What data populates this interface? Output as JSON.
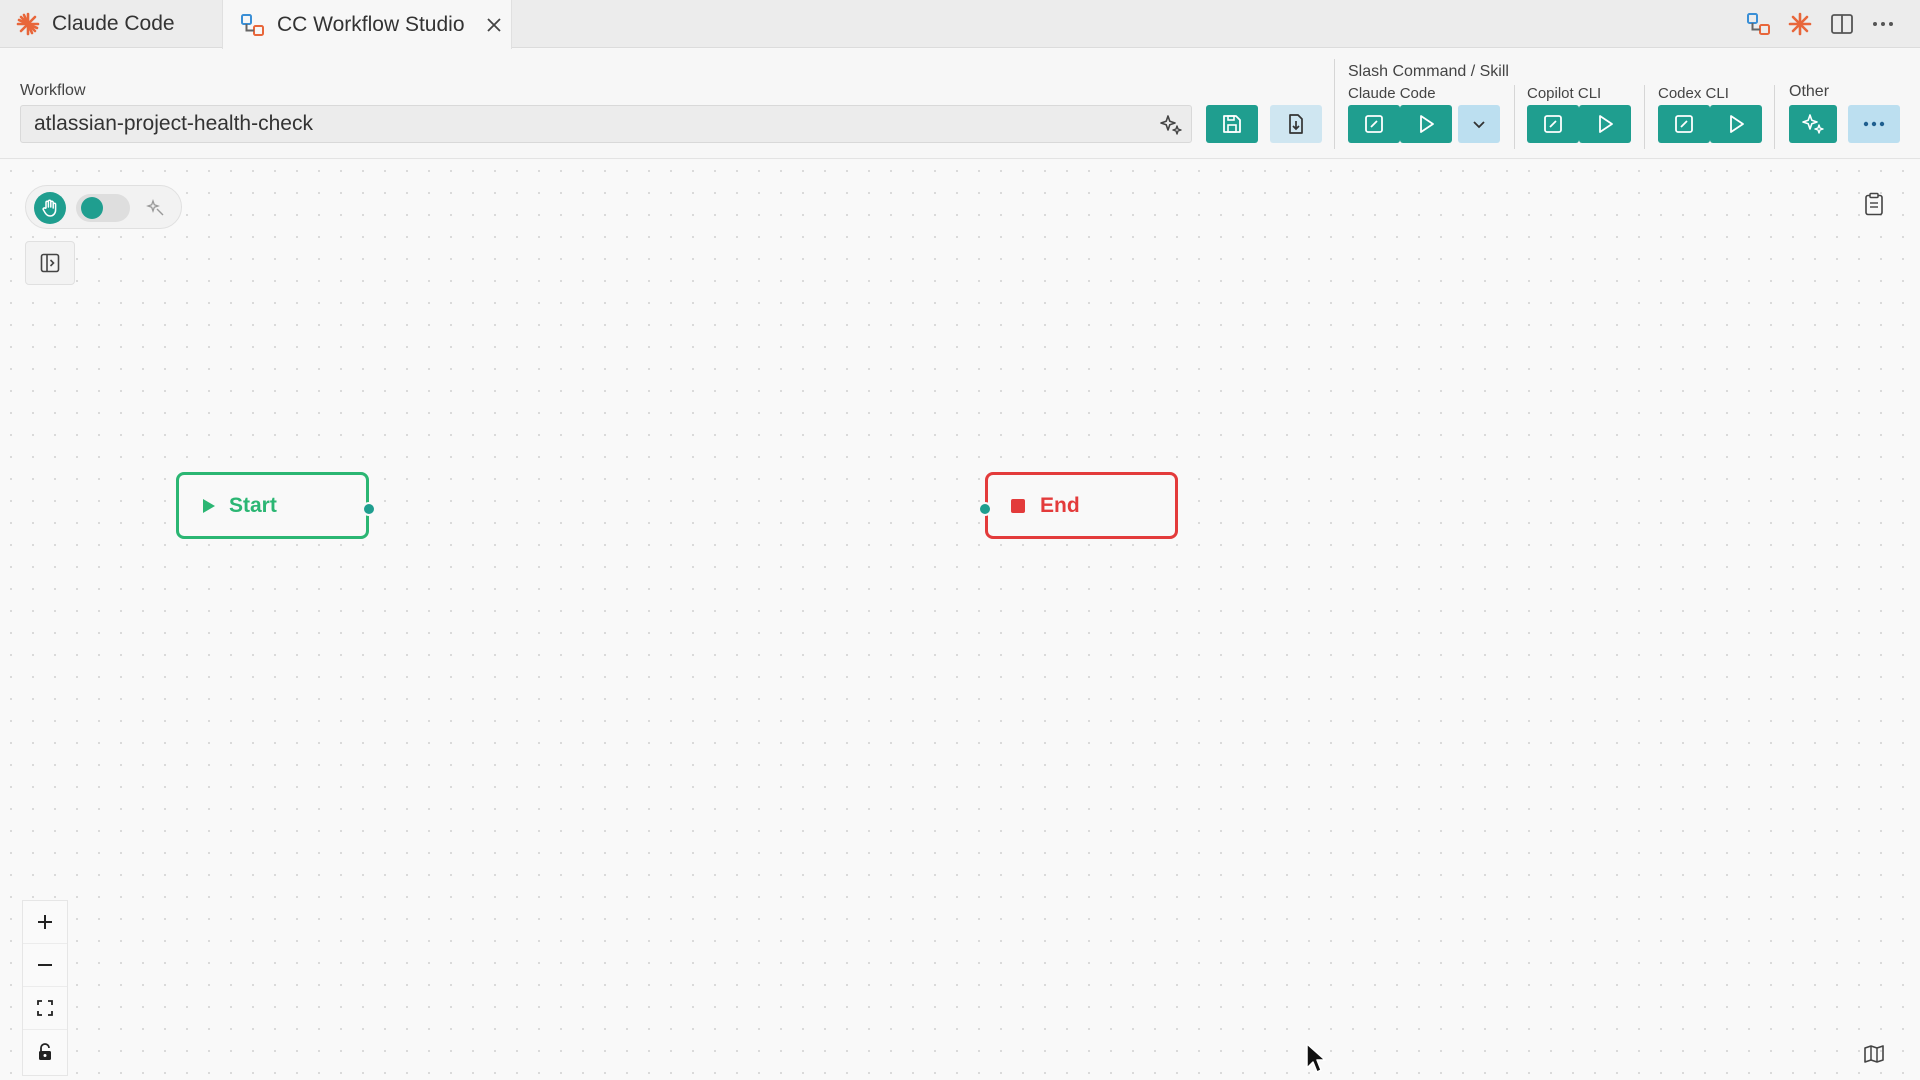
{
  "tabs": [
    {
      "label": "Claude Code",
      "icon": "claude-asterisk-icon"
    },
    {
      "label": "CC Workflow Studio",
      "icon": "workflow-studio-icon",
      "active": true
    }
  ],
  "header": {
    "workflow_label": "Workflow",
    "workflow_name": "atlassian-project-health-check",
    "section_title": "Slash Command / Skill",
    "groups": {
      "claude_code": "Claude Code",
      "copilot_cli": "Copilot CLI",
      "codex_cli": "Codex CLI",
      "other": "Other"
    }
  },
  "canvas": {
    "nodes": {
      "start": "Start",
      "end": "End"
    }
  },
  "colors": {
    "accent": "#1f9e8f",
    "start": "#2bb673",
    "end": "#e33b3b",
    "claude_orange": "#e8663a"
  }
}
